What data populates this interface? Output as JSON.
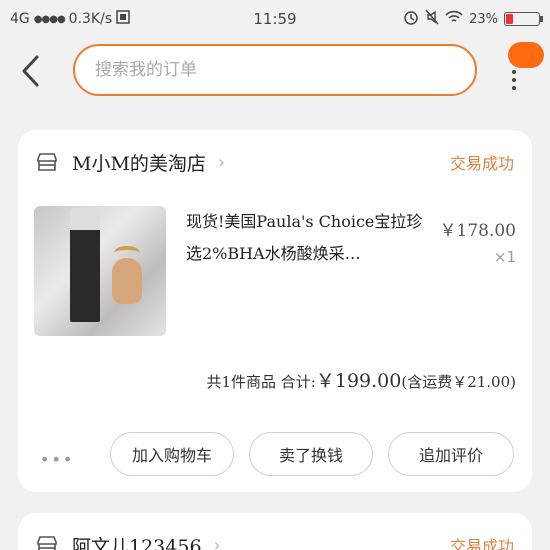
{
  "status_bar": {
    "network": "4G",
    "signal_dots": "●●●●",
    "speed": "0.3K/s",
    "time": "11:59",
    "battery_pct": "23%",
    "battery_level": 0.23,
    "icons": [
      "alarm-icon",
      "mute-icon",
      "wifi-icon",
      "battery-icon"
    ]
  },
  "header": {
    "search_placeholder": "搜索我的订单"
  },
  "orders": [
    {
      "shop_name": "M小M的美淘店",
      "status": "交易成功",
      "item": {
        "title": "现货!美国Paula's Choice宝拉珍选2%BHA水杨酸焕采…",
        "price": "￥178.00",
        "qty": "×1"
      },
      "summary_prefix": "共1件商品 合计:",
      "summary_amount": "￥199.00",
      "summary_suffix": "(含运费￥21.00)",
      "actions": {
        "more": "•••",
        "add_to_cart": "加入购物车",
        "sell_for_cash": "卖了换钱",
        "add_review": "追加评价"
      }
    },
    {
      "shop_name": "阿文儿123456",
      "status": "交易成功"
    }
  ],
  "colors": {
    "accent": "#ef7b2c",
    "status": "#e0823d",
    "badge": "#ff6a13"
  }
}
